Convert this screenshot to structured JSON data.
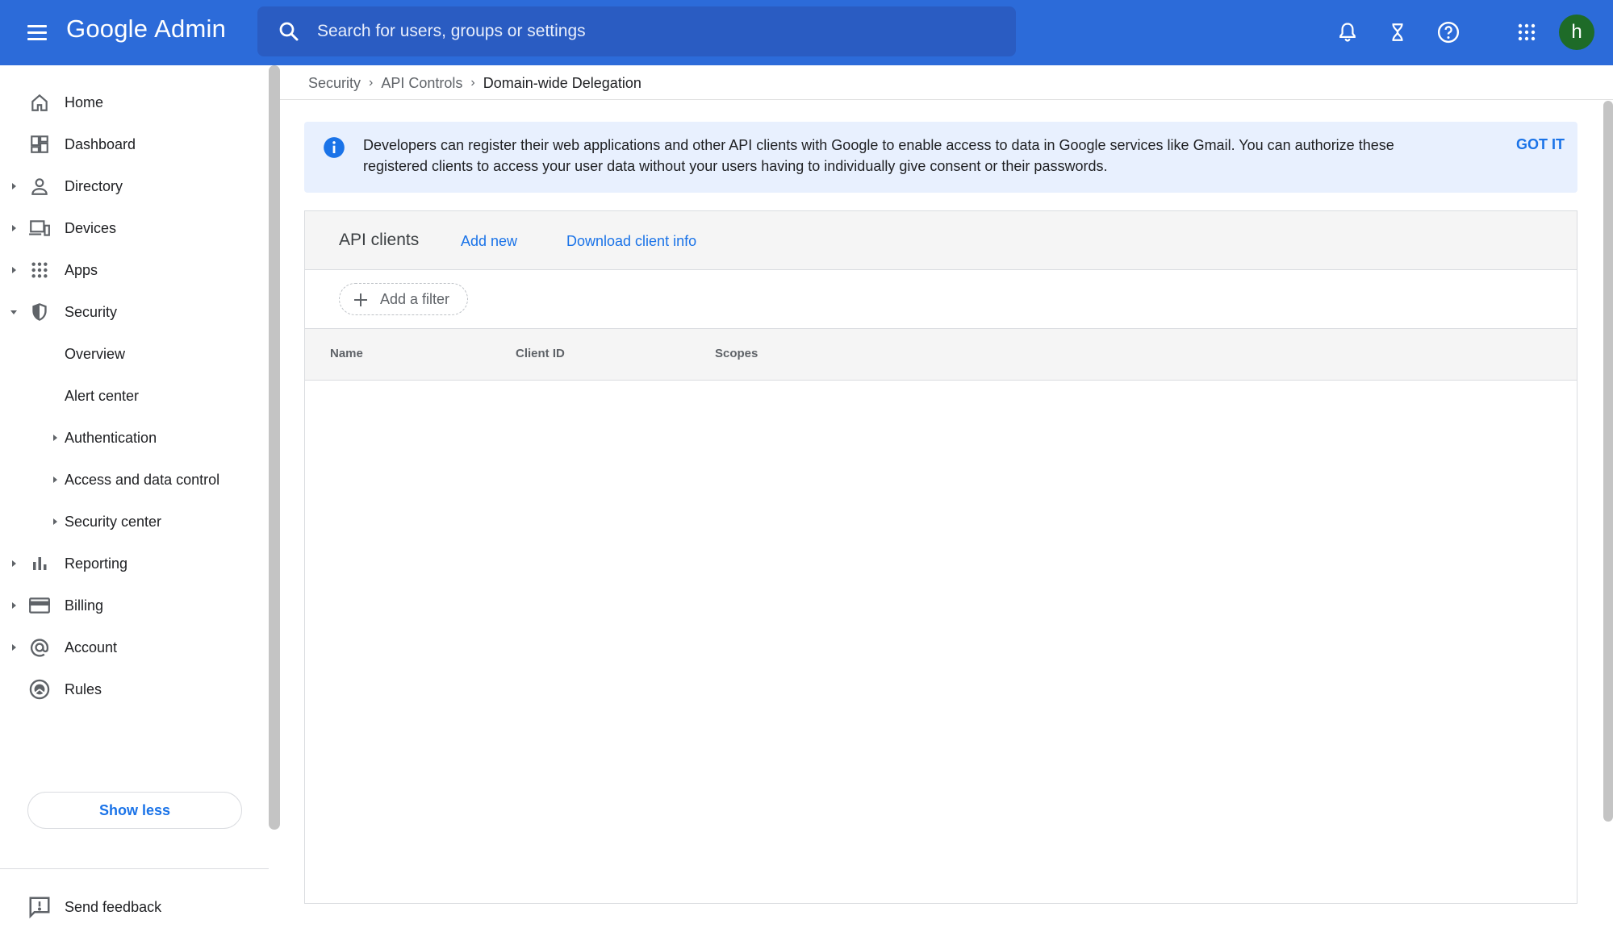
{
  "header": {
    "brand_google": "Google",
    "brand_admin": "Admin",
    "search_placeholder": "Search for users, groups or settings",
    "avatar_letter": "h"
  },
  "sidebar": {
    "items": [
      {
        "label": "Home",
        "icon": "home-icon"
      },
      {
        "label": "Dashboard",
        "icon": "dashboard-icon"
      },
      {
        "label": "Directory",
        "icon": "person-icon"
      },
      {
        "label": "Devices",
        "icon": "devices-icon"
      },
      {
        "label": "Apps",
        "icon": "apps-grid-icon"
      },
      {
        "label": "Security",
        "icon": "shield-icon"
      },
      {
        "label": "Overview"
      },
      {
        "label": "Alert center"
      },
      {
        "label": "Authentication"
      },
      {
        "label": "Access and data control"
      },
      {
        "label": "Security center"
      },
      {
        "label": "Reporting",
        "icon": "bar-chart-icon"
      },
      {
        "label": "Billing",
        "icon": "credit-card-icon"
      },
      {
        "label": "Account",
        "icon": "at-sign-icon"
      },
      {
        "label": "Rules",
        "icon": "rules-icon"
      }
    ],
    "show_less": "Show less",
    "send_feedback": "Send feedback"
  },
  "breadcrumb": {
    "items": [
      "Security",
      "API Controls"
    ],
    "current": "Domain-wide Delegation"
  },
  "banner": {
    "text": "Developers can register their web applications and other API clients with Google to enable access to data in Google services like Gmail. You can authorize these registered clients to access your user data without your users having to individually give consent or their passwords.",
    "action": "GOT IT"
  },
  "api_clients": {
    "title": "API clients",
    "add_new": "Add new",
    "download": "Download client info",
    "filter": "Add a filter",
    "columns": [
      "Name",
      "Client ID",
      "Scopes"
    ]
  },
  "colors": {
    "topbar": "#2c6bd9",
    "accent": "#1a73e8",
    "avatar": "#1e6b28"
  }
}
